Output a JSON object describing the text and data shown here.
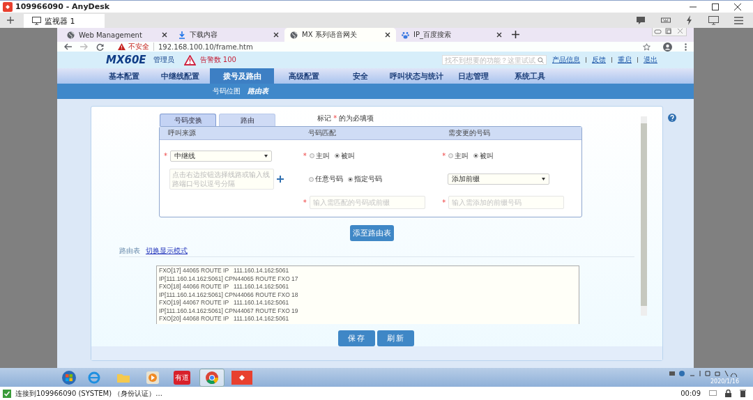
{
  "anydesk": {
    "title": "109966090 - AnyDesk",
    "session_tab": "监视器 1",
    "status": "连接到109966090 (SYSTEM) （身份认证）...",
    "timer": "00:09"
  },
  "browser": {
    "tabs": [
      {
        "label": "Web Management",
        "kind": "globe",
        "selected": false
      },
      {
        "label": "下载内容",
        "kind": "download",
        "selected": false
      },
      {
        "label": "MX 系列语音网关",
        "kind": "globe",
        "selected": true
      },
      {
        "label": "IP_百度搜索",
        "kind": "paw",
        "selected": false
      }
    ],
    "insecure": "不安全",
    "url": "192.168.100.10/frame.htm"
  },
  "header": {
    "logo": "MX60E",
    "role": "管理员",
    "alarm": "告警数 100",
    "search_placeholder": "找不到想要的功能？这里试试",
    "links": [
      "产品信息",
      "反馈",
      "重启",
      "退出"
    ]
  },
  "nav": [
    {
      "label": "基本配置",
      "selected": false
    },
    {
      "label": "中继线配置",
      "selected": false
    },
    {
      "label": "拨号及路由",
      "selected": true
    },
    {
      "label": "高级配置",
      "selected": false
    },
    {
      "label": "安全",
      "selected": false
    },
    {
      "label": "呼叫状态与统计",
      "selected": false
    },
    {
      "label": "日志管理",
      "selected": false
    },
    {
      "label": "系统工具",
      "selected": false
    }
  ],
  "subnav": [
    {
      "label": "号码位图",
      "selected": false
    },
    {
      "label": "路由表",
      "selected": true
    }
  ],
  "form": {
    "tabs": [
      {
        "label": "号码变换",
        "selected": true
      },
      {
        "label": "路由",
        "selected": false
      }
    ],
    "note": {
      "before": "标记",
      "mark": "*",
      "after": "的为必填项"
    },
    "columns": [
      "呼叫来源",
      "号码匹配",
      "需变更的号码"
    ],
    "source": {
      "mark": "*",
      "select": "中继线",
      "ports_placeholder": "点击右边按钮选择线路或输入线路端口号以逗号分隔"
    },
    "match": {
      "mark": "*",
      "caller": [
        {
          "label": "主叫",
          "selected": false
        },
        {
          "label": "被叫",
          "selected": true
        }
      ],
      "number": [
        {
          "label": "任意号码",
          "selected": false
        },
        {
          "label": "指定号码",
          "selected": true
        }
      ],
      "input_mark": "*",
      "input_placeholder": "输入需匹配的号码或前缀"
    },
    "change": {
      "mark": "*",
      "caller": [
        {
          "label": "主叫",
          "selected": false
        },
        {
          "label": "被叫",
          "selected": true
        }
      ],
      "select": "添加前缀",
      "input_mark": "*",
      "input_placeholder": "输入需添加的前缀号码"
    },
    "add_button": "添至路由表"
  },
  "route_table": {
    "title": "路由表",
    "toggle_link": "切换显示模式",
    "lines": [
      "FXO[17] 44065 ROUTE IP   111.160.14.162:5061",
      "IP[111.160.14.162:5061] CPN44065 ROUTE FXO 17",
      "FXO[18] 44066 ROUTE IP   111.160.14.162:5061",
      "IP[111.160.14.162:5061] CPN44066 ROUTE FXO 18",
      "FXO[19] 44067 ROUTE IP   111.160.14.162:5061",
      "IP[111.160.14.162:5061] CPN44067 ROUTE FXO 19",
      "FXO[20] 44068 ROUTE IP   111.160.14.162:5061"
    ]
  },
  "buttons": [
    "保存",
    "刷新"
  ],
  "taskbar": {
    "apps": [
      {
        "kind": "ie"
      },
      {
        "kind": "folder"
      },
      {
        "kind": "media"
      },
      {
        "kind": "youdao",
        "label": "有道"
      },
      {
        "kind": "chrome",
        "selected": true
      },
      {
        "kind": "anydesk",
        "selected": false
      }
    ],
    "date": "2020/1/16"
  }
}
